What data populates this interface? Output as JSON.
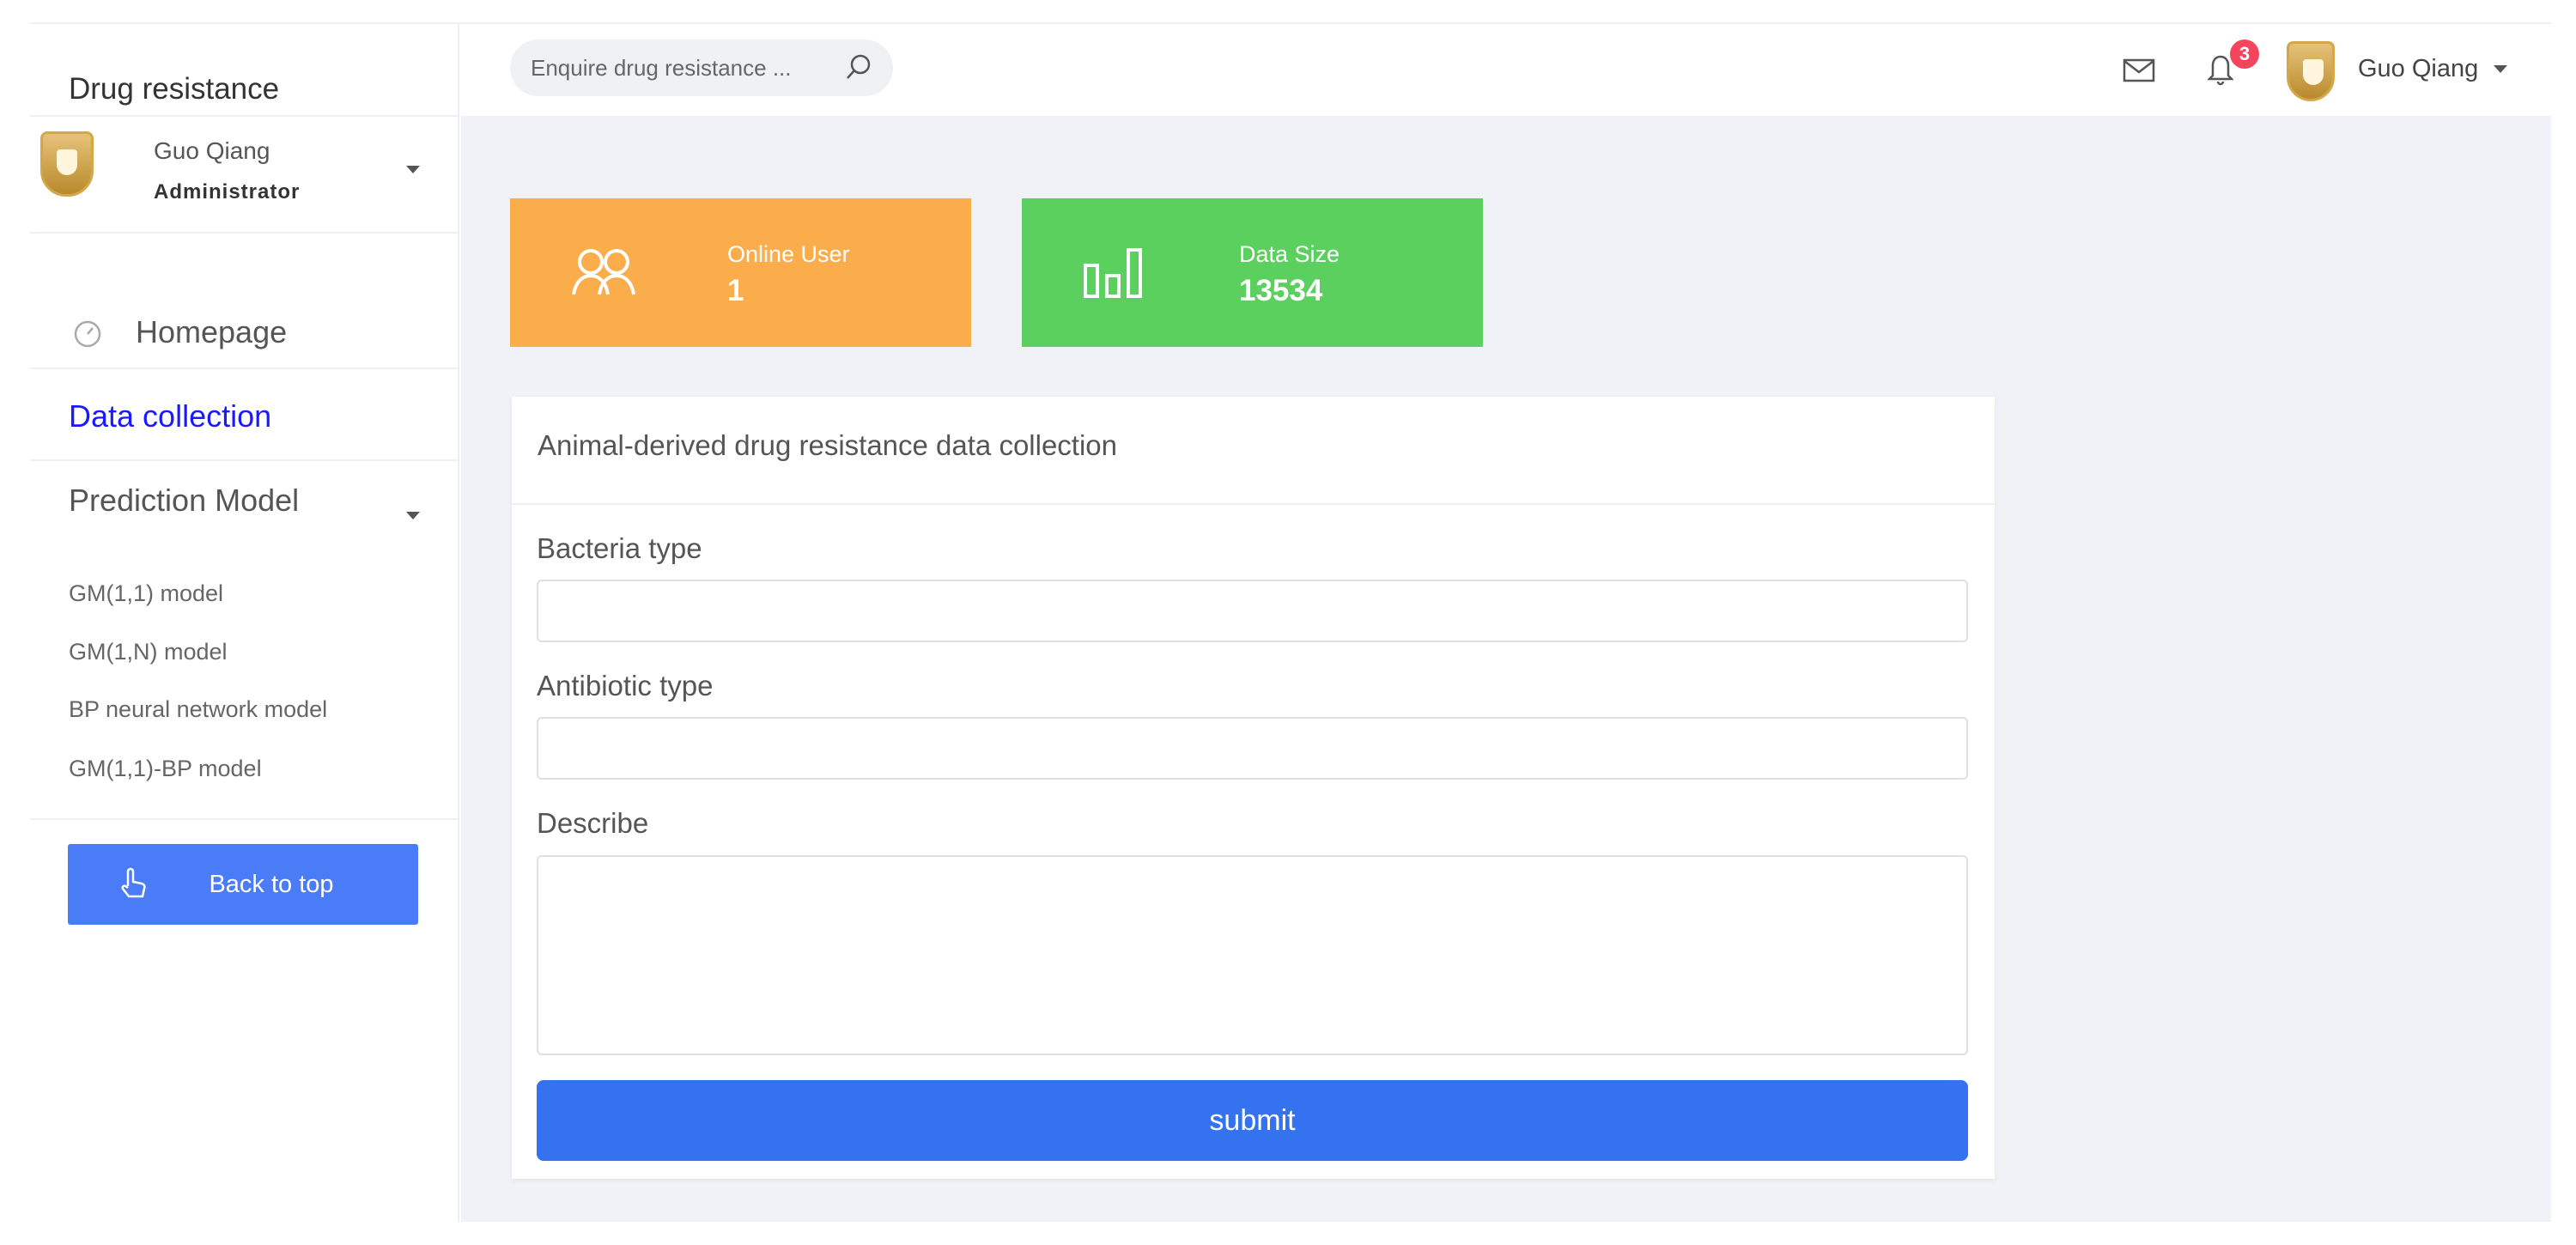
{
  "app": {
    "title": "Drug resistance"
  },
  "user": {
    "name": "Guo Qiang",
    "role": "Administrator"
  },
  "sidebar": {
    "items": [
      {
        "label": "Homepage"
      },
      {
        "label": "Data collection"
      },
      {
        "label": "Prediction Model"
      }
    ],
    "sub_items": [
      {
        "label": "GM(1,1) model"
      },
      {
        "label": "GM(1,N) model"
      },
      {
        "label": "BP neural network model"
      },
      {
        "label": "GM(1,1)-BP model"
      }
    ],
    "back_to_top": "Back to top"
  },
  "header": {
    "search_placeholder": "Enquire drug resistance ...",
    "notification_count": "3",
    "user_name": "Guo Qiang"
  },
  "cards": [
    {
      "label": "Online User",
      "value": "1",
      "color": "#fbad4c"
    },
    {
      "label": "Data Size",
      "value": "13534",
      "color": "#5bd05e"
    }
  ],
  "form": {
    "title": "Animal-derived drug resistance data collection",
    "fields": [
      {
        "label": "Bacteria type",
        "value": ""
      },
      {
        "label": "Antibiotic type",
        "value": ""
      },
      {
        "label": "Describe",
        "value": ""
      }
    ],
    "submit": "submit"
  },
  "colors": {
    "active_menu": "#1a1aff",
    "primary": "#3572ef"
  }
}
